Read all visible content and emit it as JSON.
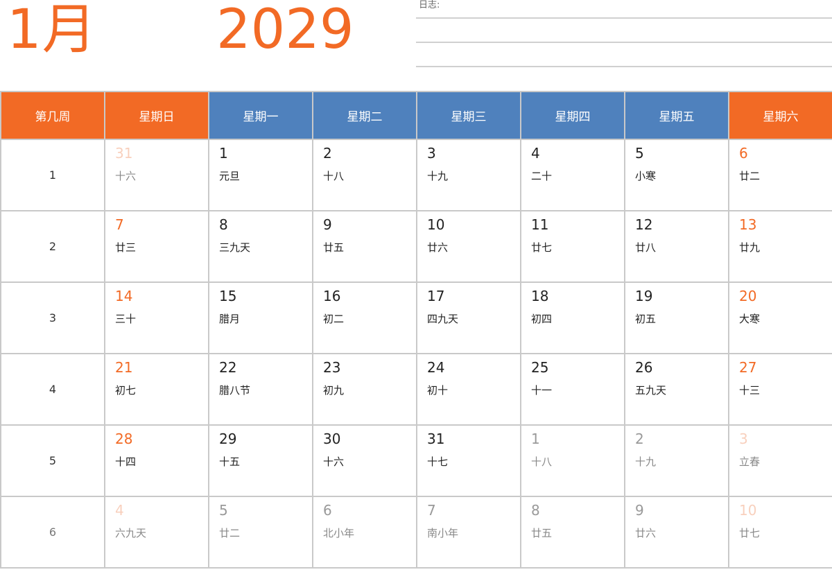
{
  "header": {
    "month": "1月",
    "year": "2029",
    "notes_label": "日志:"
  },
  "colors": {
    "accent_orange": "#f26a25",
    "header_blue": "#4f81bd"
  },
  "columns": [
    "第几周",
    "星期日",
    "星期一",
    "星期二",
    "星期三",
    "星期四",
    "星期五",
    "星期六"
  ],
  "weeks": [
    {
      "week": "1",
      "days": [
        {
          "num": "31",
          "lunar": "十六"
        },
        {
          "num": "1",
          "lunar": "元旦"
        },
        {
          "num": "2",
          "lunar": "十八"
        },
        {
          "num": "3",
          "lunar": "十九"
        },
        {
          "num": "4",
          "lunar": "二十"
        },
        {
          "num": "5",
          "lunar": "小寒"
        },
        {
          "num": "6",
          "lunar": "廿二"
        }
      ]
    },
    {
      "week": "2",
      "days": [
        {
          "num": "7",
          "lunar": "廿三"
        },
        {
          "num": "8",
          "lunar": "三九天"
        },
        {
          "num": "9",
          "lunar": "廿五"
        },
        {
          "num": "10",
          "lunar": "廿六"
        },
        {
          "num": "11",
          "lunar": "廿七"
        },
        {
          "num": "12",
          "lunar": "廿八"
        },
        {
          "num": "13",
          "lunar": "廿九"
        }
      ]
    },
    {
      "week": "3",
      "days": [
        {
          "num": "14",
          "lunar": "三十"
        },
        {
          "num": "15",
          "lunar": "腊月"
        },
        {
          "num": "16",
          "lunar": "初二"
        },
        {
          "num": "17",
          "lunar": "四九天"
        },
        {
          "num": "18",
          "lunar": "初四"
        },
        {
          "num": "19",
          "lunar": "初五"
        },
        {
          "num": "20",
          "lunar": "大寒"
        }
      ]
    },
    {
      "week": "4",
      "days": [
        {
          "num": "21",
          "lunar": "初七"
        },
        {
          "num": "22",
          "lunar": "腊八节"
        },
        {
          "num": "23",
          "lunar": "初九"
        },
        {
          "num": "24",
          "lunar": "初十"
        },
        {
          "num": "25",
          "lunar": "十一"
        },
        {
          "num": "26",
          "lunar": "五九天"
        },
        {
          "num": "27",
          "lunar": "十三"
        }
      ]
    },
    {
      "week": "5",
      "days": [
        {
          "num": "28",
          "lunar": "十四"
        },
        {
          "num": "29",
          "lunar": "十五"
        },
        {
          "num": "30",
          "lunar": "十六"
        },
        {
          "num": "31",
          "lunar": "十七"
        },
        {
          "num": "1",
          "lunar": "十八"
        },
        {
          "num": "2",
          "lunar": "十九"
        },
        {
          "num": "3",
          "lunar": "立春"
        }
      ]
    },
    {
      "week": "6",
      "days": [
        {
          "num": "4",
          "lunar": "六九天"
        },
        {
          "num": "5",
          "lunar": "廿二"
        },
        {
          "num": "6",
          "lunar": "北小年"
        },
        {
          "num": "7",
          "lunar": "南小年"
        },
        {
          "num": "8",
          "lunar": "廿五"
        },
        {
          "num": "9",
          "lunar": "廿六"
        },
        {
          "num": "10",
          "lunar": "廿七"
        }
      ]
    }
  ]
}
